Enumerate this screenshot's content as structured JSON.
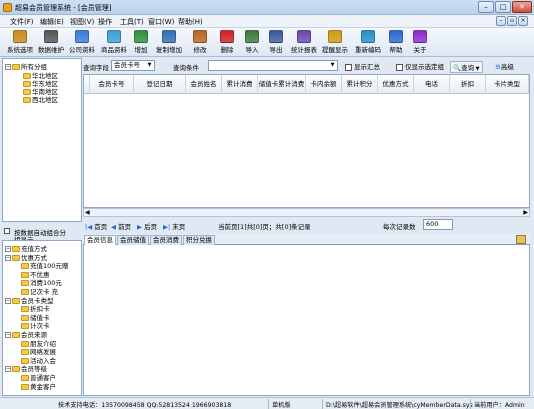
{
  "window": {
    "title": "超易会员管理系统 - [会员管理]"
  },
  "menu": [
    "文件(F)",
    "编辑(E)",
    "视图(V)",
    "操作",
    "工具(T)",
    "窗口(W)",
    "帮助(H)"
  ],
  "toolbar": [
    {
      "label": "系统选项",
      "icon": "tools-icon",
      "color": "#c98a1a"
    },
    {
      "label": "数据维护",
      "icon": "scissors-icon",
      "color": "#555555"
    },
    {
      "label": "公司资料",
      "icon": "users-icon",
      "color": "#3a7bd5"
    },
    {
      "label": "商品资料",
      "icon": "products-icon",
      "color": "#3aa0d5"
    },
    {
      "label": "增加",
      "icon": "add-icon",
      "color": "#2f8f3a"
    },
    {
      "label": "复制增加",
      "icon": "copy-add-icon",
      "color": "#2f6fb5"
    },
    {
      "label": "修改",
      "icon": "pencil-icon",
      "color": "#b5651d"
    },
    {
      "label": "删除",
      "icon": "delete-icon",
      "color": "#d02020"
    },
    {
      "label": "导入",
      "icon": "import-icon",
      "color": "#3b7a3b"
    },
    {
      "label": "导出",
      "icon": "export-icon",
      "color": "#3b5a9a"
    },
    {
      "label": "统计报表",
      "icon": "report-icon",
      "color": "#6a4aa5"
    },
    {
      "label": "提醒显示",
      "icon": "bell-icon",
      "color": "#d09a10"
    },
    {
      "label": "重新编码",
      "icon": "recode-icon",
      "color": "#2a8fc0"
    },
    {
      "label": "帮助",
      "icon": "help-icon",
      "color": "#2a6ad0"
    },
    {
      "label": "关于",
      "icon": "about-icon",
      "color": "#8a2ad0"
    }
  ],
  "tree_top": {
    "root": "所有分组",
    "children": [
      "华北地区",
      "华东地区",
      "华南地区",
      "西北地区"
    ]
  },
  "tree_bottom": {
    "header_line1": "按数据自动组合分",
    "header_line2": "组显示",
    "nodes": [
      {
        "label": "充值方式",
        "level": 0,
        "folder": true
      },
      {
        "label": "优惠方式",
        "level": 0,
        "folder": true
      },
      {
        "label": "充值100元赠",
        "level": 1,
        "folder": true
      },
      {
        "label": "不优惠",
        "level": 1,
        "folder": true
      },
      {
        "label": "消费100元",
        "level": 1,
        "folder": true
      },
      {
        "label": "记次卡 充",
        "level": 1,
        "folder": true
      },
      {
        "label": "会员卡类型",
        "level": 0,
        "folder": true
      },
      {
        "label": "折扣卡",
        "level": 1,
        "folder": true
      },
      {
        "label": "储值卡",
        "level": 1,
        "folder": true
      },
      {
        "label": "计次卡",
        "level": 1,
        "folder": true
      },
      {
        "label": "会员来源",
        "level": 0,
        "folder": true
      },
      {
        "label": "朋友介绍",
        "level": 1,
        "folder": true
      },
      {
        "label": "网络发展",
        "level": 1,
        "folder": true
      },
      {
        "label": "活动入会",
        "level": 1,
        "folder": true
      },
      {
        "label": "会员等级",
        "level": 0,
        "folder": true
      },
      {
        "label": "普通客户",
        "level": 1,
        "folder": true
      },
      {
        "label": "黄金客户",
        "level": 1,
        "folder": true
      }
    ]
  },
  "filters": {
    "field_label": "查询字段",
    "field_value": "会员卡号",
    "cond_label": "查询条件",
    "cond_value": "",
    "show_summary": "显示汇总",
    "only_selected": "仅显示选定组",
    "search_btn": "查询",
    "advanced_btn": "高级"
  },
  "grid": {
    "columns": [
      "会员卡号",
      "登记日期",
      "会员姓名",
      "累计消费",
      "储值卡累计消费",
      "卡内余额",
      "累计积分",
      "优惠方式",
      "电话",
      "折扣",
      "卡片类型"
    ]
  },
  "pager": {
    "first": "首页",
    "prev": "前页",
    "next": "后页",
    "last": "末页",
    "info": "当前页[1]共[0]页；共[0]条记录",
    "per_page_label": "每次记录数",
    "per_page": "600"
  },
  "tabs": [
    "会员信息",
    "会员储值",
    "会员消费",
    "积分兑换"
  ],
  "status": {
    "support": "技术支持电话：13570098458 QQ:52813524 1966903818",
    "mode": "单机版",
    "path": "D:\\超易软件\\超易会员管理系统\\cyMemberData.sys",
    "user": "当前用户：Admin"
  }
}
